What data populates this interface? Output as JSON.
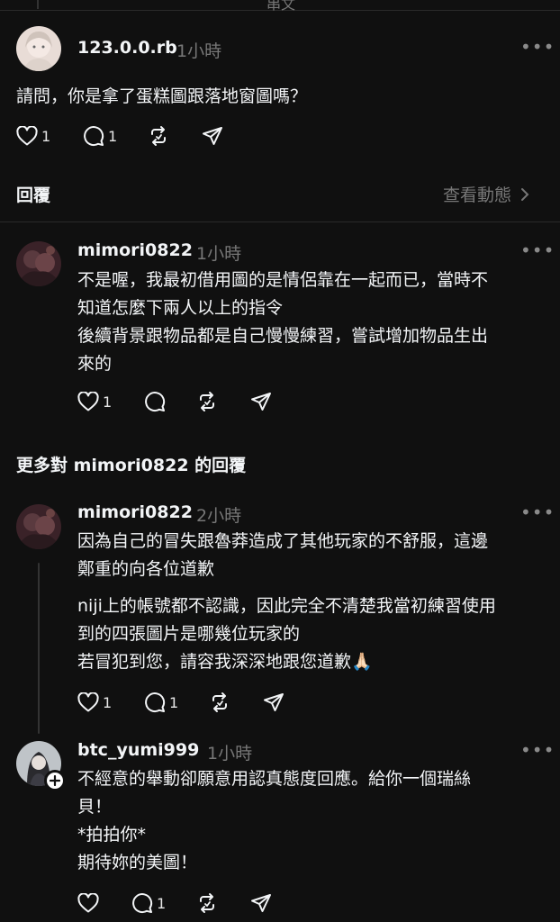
{
  "top": {
    "cut_title": "串文"
  },
  "post": {
    "username": "123.0.0.rb",
    "time": "1小時",
    "text": "請問，你是拿了蛋糕圖跟落地窗圖嗎？",
    "like_count": "1",
    "reply_count": "1"
  },
  "section": {
    "label": "回覆",
    "view_activity": "查看動態"
  },
  "reply1": {
    "username": "mimori0822",
    "time": "1小時",
    "lines": [
      "不是喔，我最初借用圖的是情侶靠在一起而已，當時不",
      "知道怎麼下兩人以上的指令",
      "後續背景跟物品都是自己慢慢練習，嘗試增加物品生出",
      "來的"
    ],
    "like_count": "1"
  },
  "more_replies_header": "更多對 mimori0822 的回覆",
  "reply2": {
    "username": "mimori0822",
    "time": "2小時",
    "lines": [
      "因為自己的冒失跟魯莽造成了其他玩家的不舒服，這邊",
      "鄭重的向各位道歉",
      "niji上的帳號都不認識，因此完全不清楚我當初練習使用",
      "到的四張圖片是哪幾位玩家的",
      "若冒犯到您，請容我深深地跟您道歉🙏🏻"
    ],
    "like_count": "1",
    "reply_count": "1"
  },
  "reply3": {
    "username": "btc_yumi999",
    "time": "1小時",
    "lines": [
      "不經意的舉動卻願意用認真態度回應。給你一個瑞絲",
      "貝！",
      "*拍拍你*",
      "期待妳的美圖！"
    ],
    "reply_count": "1"
  },
  "icons": {
    "like": "heart-icon",
    "reply": "comment-icon",
    "repost": "repost-icon",
    "share": "send-icon",
    "more": "more-icon",
    "chevron": "chevron-right-icon",
    "follow": "plus-icon"
  },
  "colors": {
    "background": "#101010",
    "text": "#f3f5f7",
    "muted": "#777777",
    "divider": "#2a2a2a"
  }
}
